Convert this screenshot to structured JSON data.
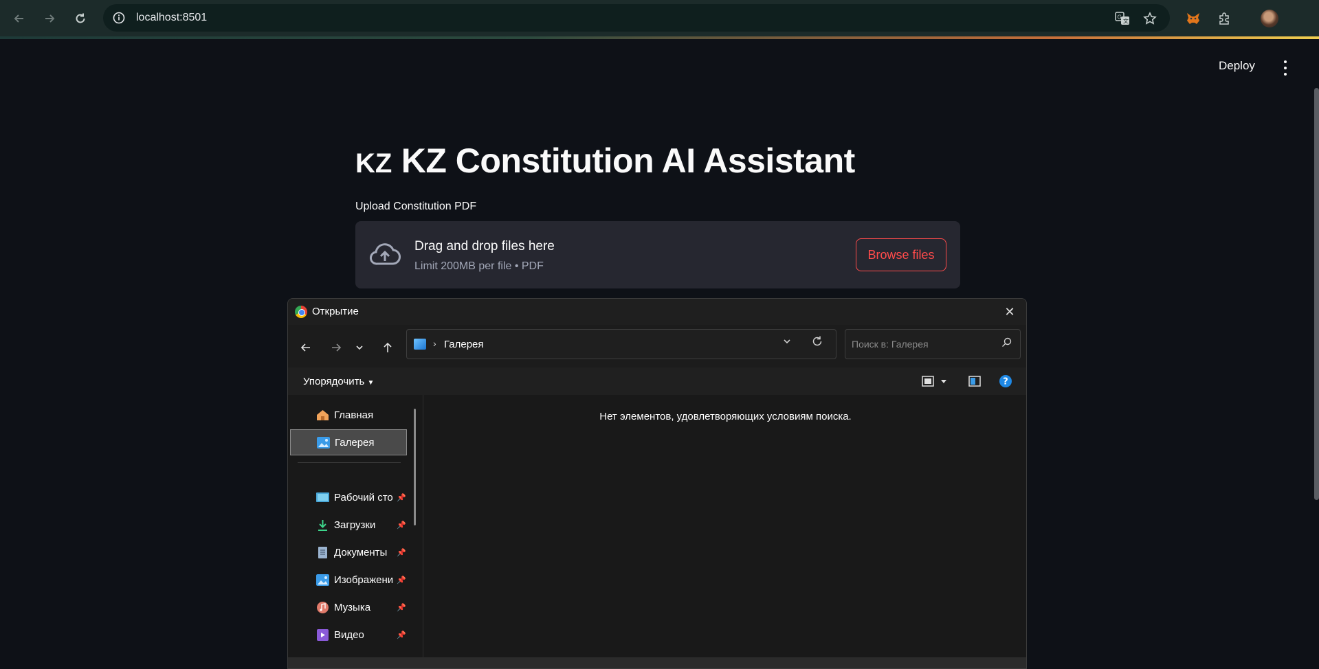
{
  "browser": {
    "url": "localhost:8501"
  },
  "app": {
    "deploy_label": "Deploy",
    "title_flag": "KZ",
    "title_text": "KZ Constitution AI Assistant",
    "upload_label": "Upload Constitution PDF",
    "dropzone_main": "Drag and drop files here",
    "dropzone_sub": "Limit 200MB per file • PDF",
    "browse_label": "Browse files",
    "accent_color": "#ff4b4b"
  },
  "dialog": {
    "title": "Открытие",
    "breadcrumb": "Галерея",
    "search_placeholder": "Поиск в: Галерея",
    "organize_label": "Упорядочить",
    "empty_message": "Нет элементов, удовлетворяющих условиям поиска.",
    "nav_items": [
      {
        "label": "Главная",
        "icon": "home-icon",
        "pinned": false,
        "selected": false
      },
      {
        "label": "Галерея",
        "icon": "gallery-icon",
        "pinned": false,
        "selected": true
      },
      {
        "label": "Рабочий сто",
        "icon": "desktop-icon",
        "pinned": true,
        "selected": false
      },
      {
        "label": "Загрузки",
        "icon": "downloads-icon",
        "pinned": true,
        "selected": false
      },
      {
        "label": "Документы",
        "icon": "documents-icon",
        "pinned": true,
        "selected": false
      },
      {
        "label": "Изображени",
        "icon": "pictures-icon",
        "pinned": true,
        "selected": false
      },
      {
        "label": "Музыка",
        "icon": "music-icon",
        "pinned": true,
        "selected": false
      },
      {
        "label": "Видео",
        "icon": "videos-icon",
        "pinned": true,
        "selected": false
      }
    ]
  }
}
